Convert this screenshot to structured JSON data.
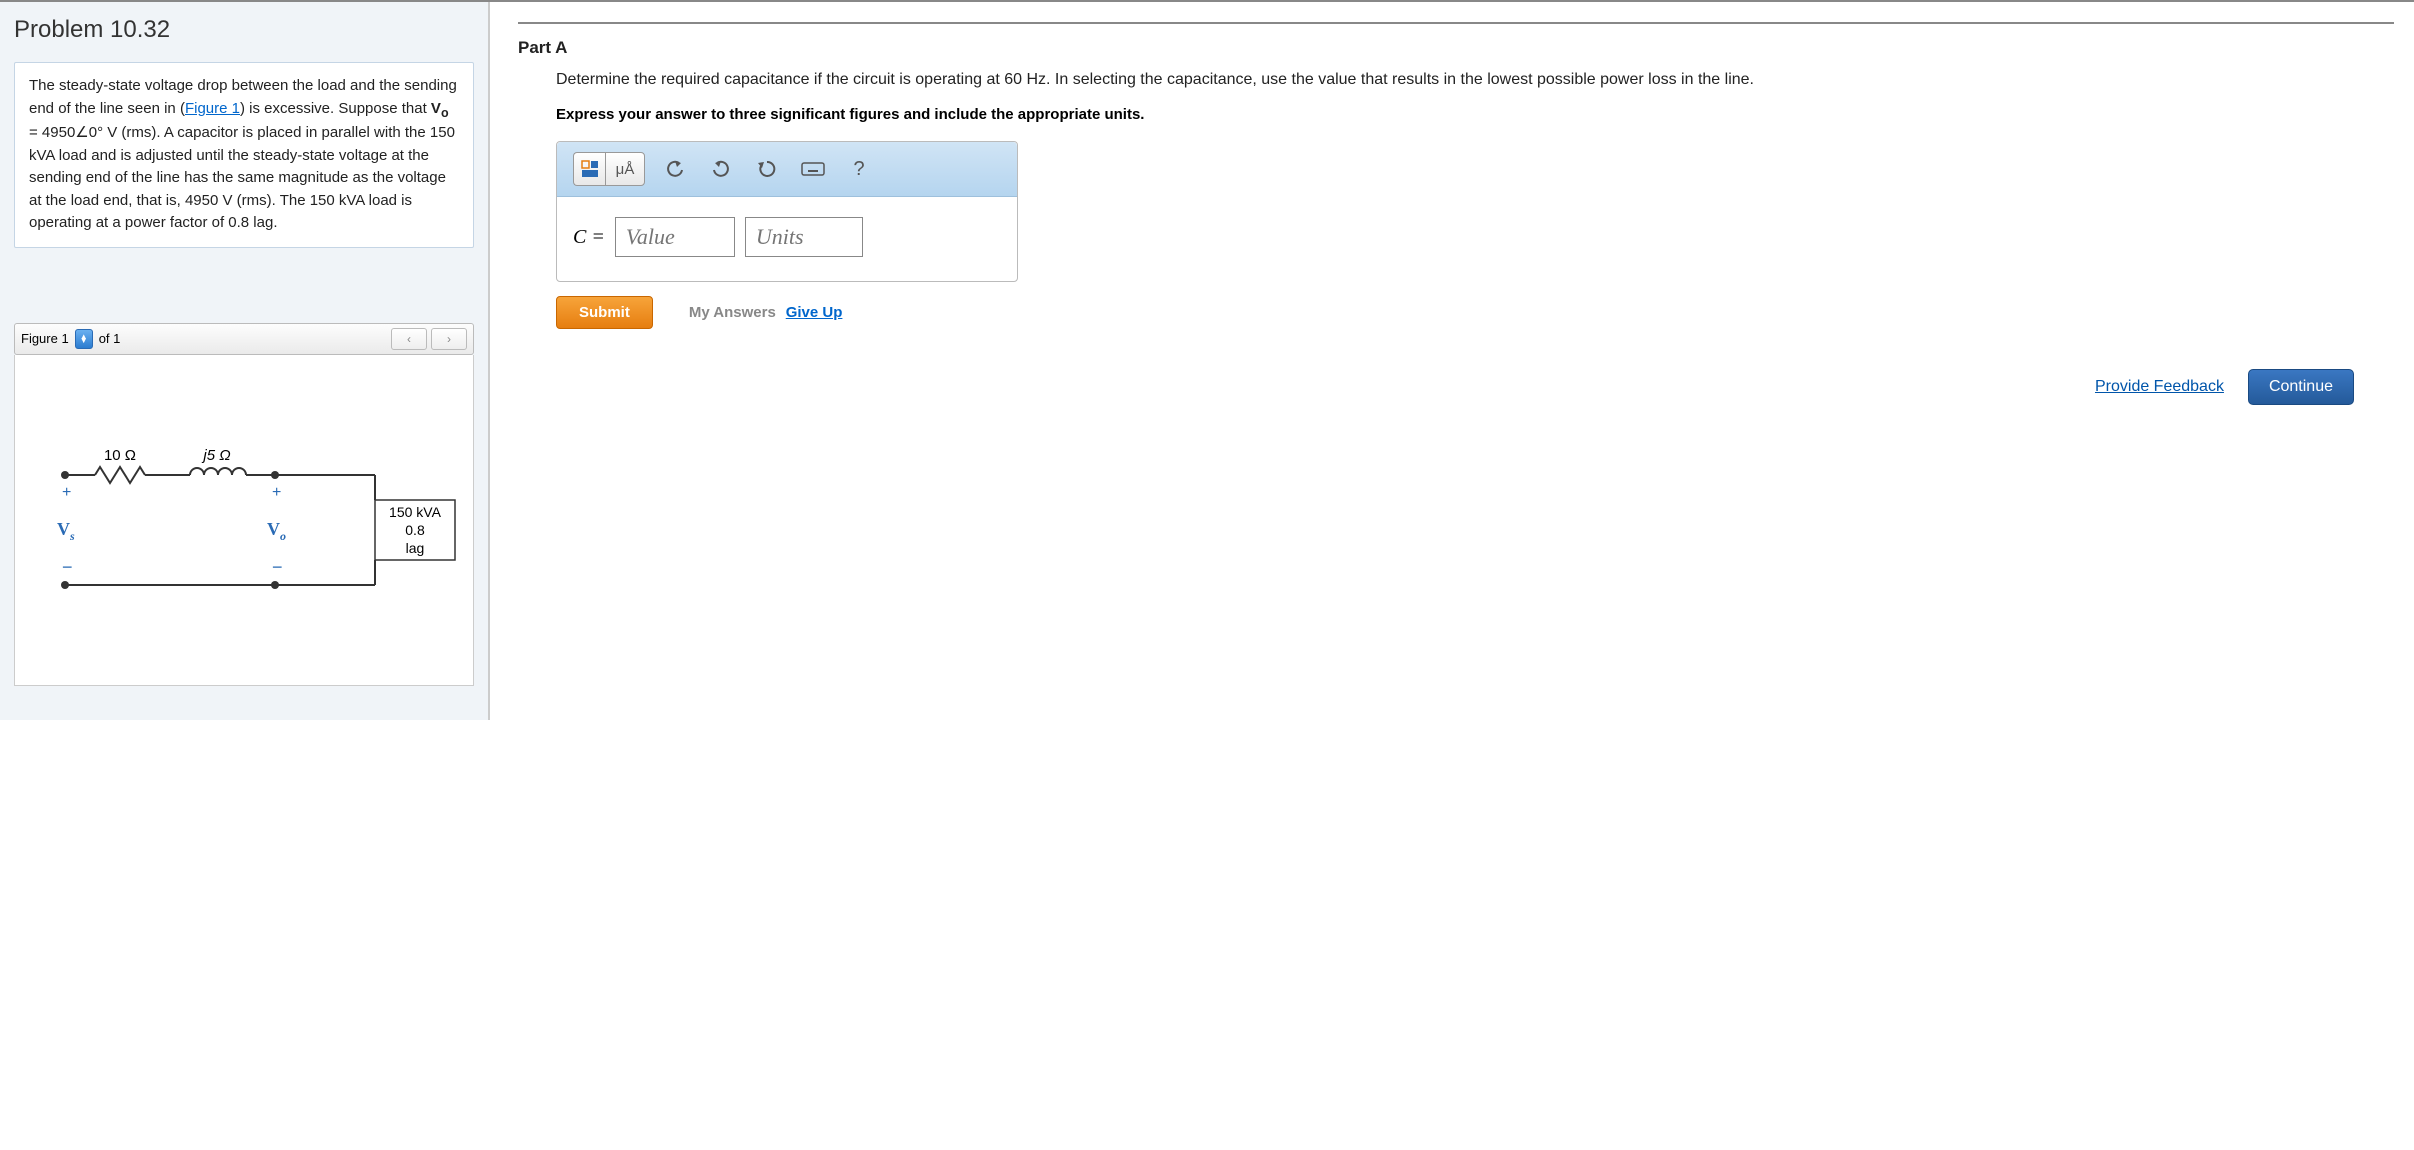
{
  "problem": {
    "title": "Problem 10.32",
    "text_pre": "The steady-state voltage drop between the load and the sending end of the line seen in (",
    "figure_link": "Figure 1",
    "text_mid": ") is excessive. Suppose that ",
    "vo_expr": "V",
    "vo_sub": "o",
    "vo_eq": " = 4950∠0° V (rms)",
    "text_after_vo": ". A capacitor is placed in parallel with the 150 kVA load and is adjusted until the steady-state voltage at the sending end of the line has the same magnitude as the voltage at the load end, that is, 4950 V (rms). The 150 kVA load is operating at a power factor of 0.8 lag."
  },
  "figure": {
    "label": "Figure 1",
    "of_text": "of 1",
    "r_label": "10 Ω",
    "l_label": "j5 Ω",
    "vs_label": "V",
    "vs_sub": "s",
    "vo_label": "V",
    "vo_sub2": "o",
    "load_line1": "150 kVA",
    "load_line2": "0.8",
    "load_line3": "lag"
  },
  "partA": {
    "title": "Part A",
    "question": "Determine the required capacitance if the circuit is operating at 60 Hz. In selecting the capacitance, use the value that results in the lowest possible power loss in the line.",
    "instruction": "Express your answer to three significant figures and include the appropriate units.",
    "var_label": "C =",
    "value_placeholder": "Value",
    "units_placeholder": "Units",
    "toolbar": {
      "units_btn": "μÅ",
      "help_btn": "?"
    },
    "submit": "Submit",
    "my_answers": "My Answers",
    "give_up": "Give Up"
  },
  "footer": {
    "feedback": "Provide Feedback",
    "continue": "Continue"
  }
}
